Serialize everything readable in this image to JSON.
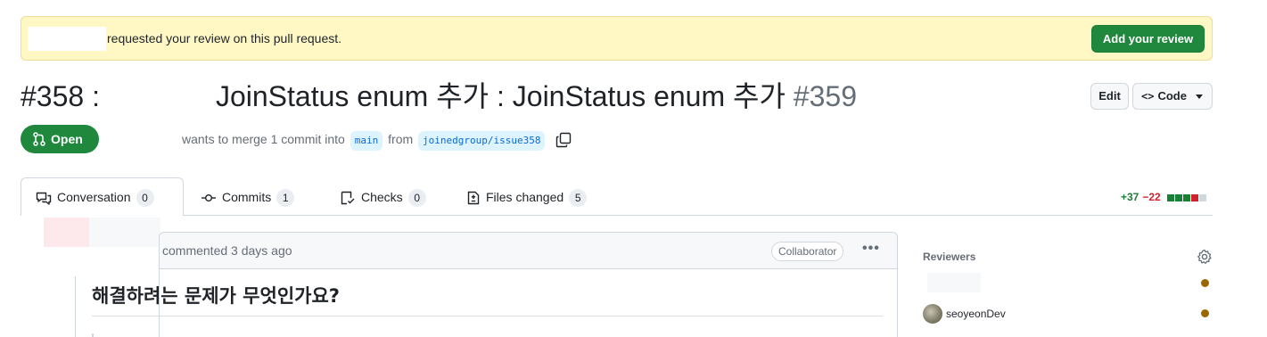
{
  "banner": {
    "message": "requested your review on this pull request.",
    "button_label": "Add your review"
  },
  "pr": {
    "title_prefix": "#358 :",
    "title_main": "JoinStatus enum 추가 : JoinStatus enum 추가",
    "number": "#359",
    "state_label": "Open",
    "merge_text_1": "wants to merge 1 commit into",
    "base_branch": "main",
    "merge_text_2": "from",
    "head_branch": "joinedgroup/issue358"
  },
  "header_actions": {
    "edit_label": "Edit",
    "code_label": "Code"
  },
  "tabs": [
    {
      "label": "Conversation",
      "count": "0",
      "icon": "conversation-icon"
    },
    {
      "label": "Commits",
      "count": "1",
      "icon": "commit-icon"
    },
    {
      "label": "Checks",
      "count": "0",
      "icon": "checklist-icon"
    },
    {
      "label": "Files changed",
      "count": "5",
      "icon": "file-diff-icon"
    }
  ],
  "diffstat": {
    "additions": "+37",
    "deletions": "−22",
    "colors": {
      "add": "#1a7f37",
      "del": "#cf222e",
      "neutral": "#d0d7de"
    }
  },
  "comment": {
    "meta": "commented 3 days ago",
    "role_badge": "Collaborator",
    "menu_label": "•••",
    "heading": "해결하려는 문제가 무엇인가요?"
  },
  "sidebar": {
    "reviewers_label": "Reviewers",
    "reviewers": [
      {
        "name": "",
        "status_color": "#9a6700"
      },
      {
        "name": "seoyeonDev",
        "status_color": "#9a6700"
      }
    ]
  },
  "colors": {
    "accent_green": "#1f883d",
    "banner_bg": "#fff8c5",
    "link_blue": "#0969da"
  }
}
